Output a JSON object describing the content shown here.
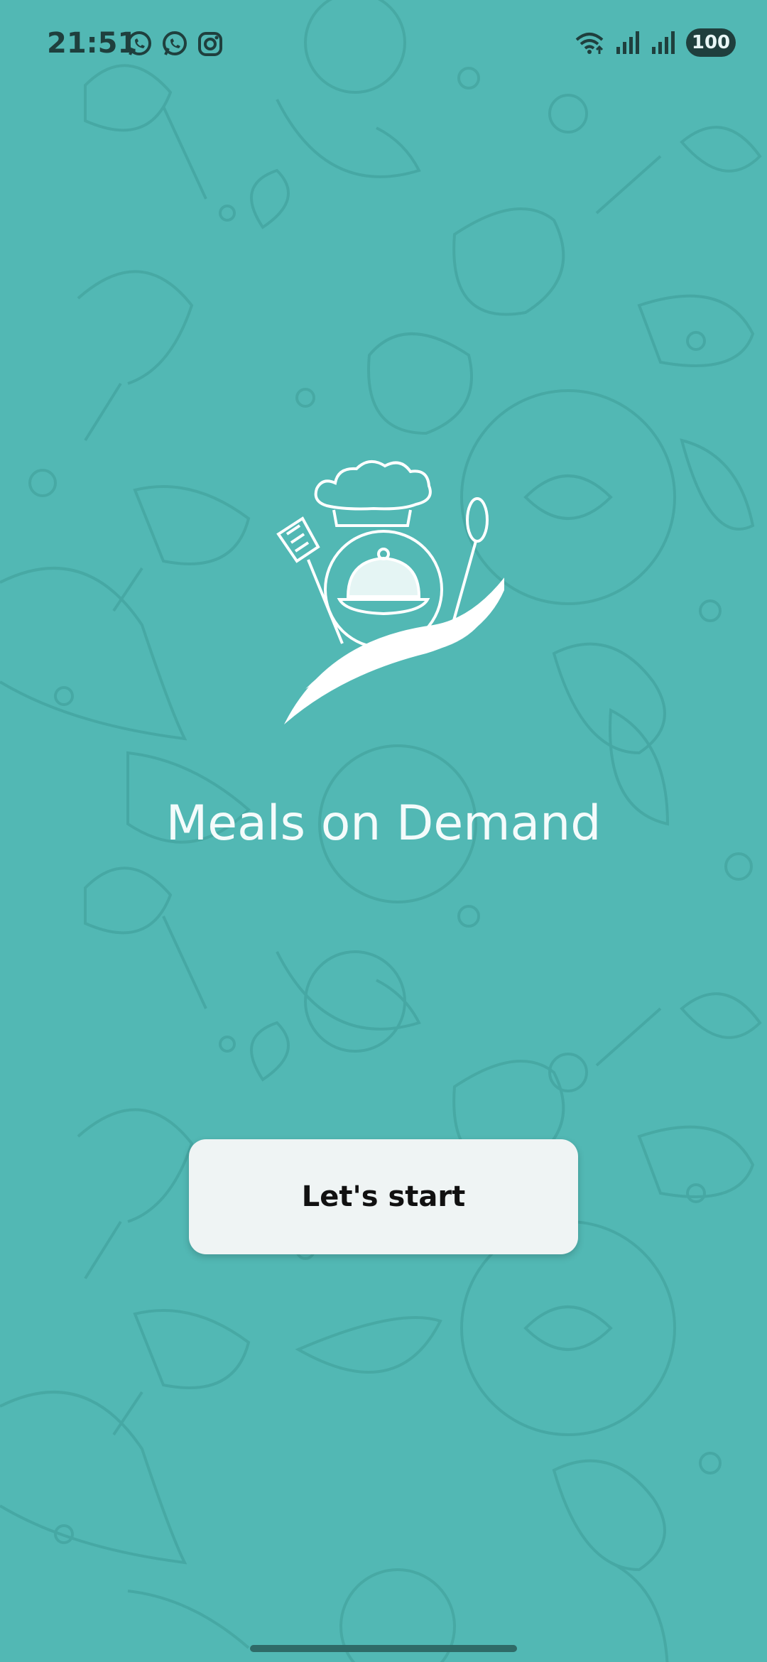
{
  "status_bar": {
    "time": "21:51",
    "left_icons": [
      "whatsapp-icon",
      "whatsapp-icon",
      "instagram-icon"
    ],
    "right_icons": [
      "wifi-icon",
      "signal-icon",
      "signal-icon"
    ],
    "battery": "100"
  },
  "app": {
    "title": "Meals on Demand"
  },
  "start_button": {
    "label": "Let's start"
  },
  "colors": {
    "background": "#52b8b4",
    "pattern": "#3e9c98",
    "button": "#eff4f4",
    "title": "#f4fbfb",
    "status": "#1f3f3d"
  }
}
